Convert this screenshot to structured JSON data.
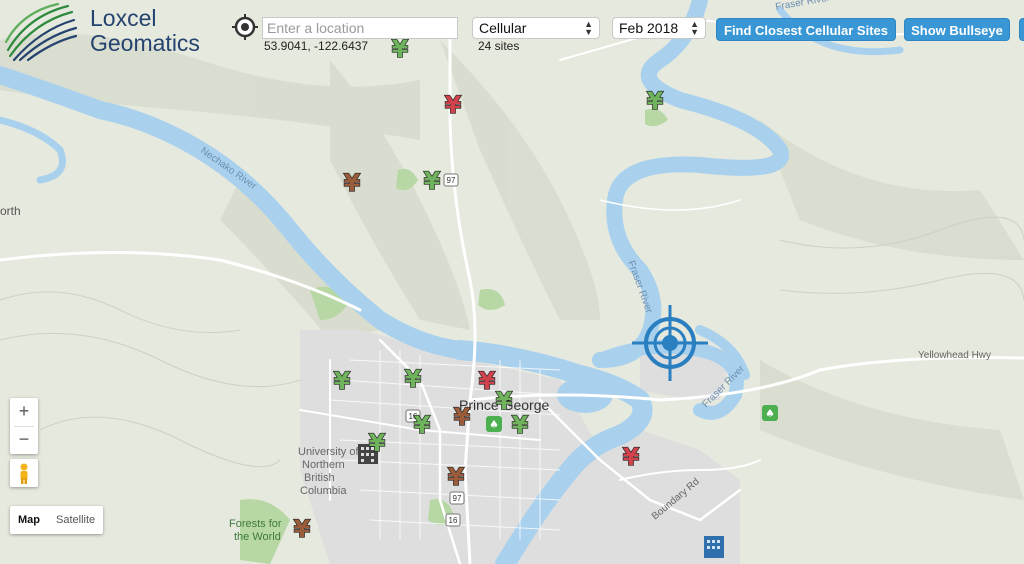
{
  "logo": {
    "line1": "Loxcel",
    "line2": "Geomatics"
  },
  "search": {
    "placeholder": "Enter a location",
    "coords": "53.9041, -122.6437"
  },
  "network_select": {
    "value": "Cellular",
    "sites": "24 sites"
  },
  "date_select": {
    "value": "Feb 2018"
  },
  "buttons": {
    "closest": "Find Closest Cellular Sites",
    "bullseye": "Show Bullseye"
  },
  "map_controls": {
    "zoom_in": "+",
    "zoom_out": "−",
    "map": "Map",
    "satellite": "Satellite"
  },
  "labels": {
    "city": "Prince George",
    "fraser_river_north": "Fraser River",
    "fraser_river_mid": "Fraser River",
    "fraser_river_south": "Fraser River",
    "nechako_river": "Nechako River",
    "yellowhead": "Yellowhead Hwy",
    "boundary_rd": "Boundary Rd",
    "univ1": "University of",
    "univ2": "Northern",
    "univ3": "British",
    "univ4": "Columbia",
    "forests1": "Forests for",
    "forests2": "the World",
    "north_edge": "orth",
    "hwy97_a": "97",
    "hwy97_b": "97",
    "hwy16_a": "16",
    "hwy16_b": "16"
  },
  "marker_symbol": "¥",
  "colors": {
    "marker_green": "#6fb35c",
    "marker_red": "#d0434d",
    "marker_brown": "#9a5c3a",
    "bullseye": "#2a7fc0",
    "button": "#3a97d6",
    "water": "#a9d1ee",
    "urban": "#dcdcdc"
  }
}
